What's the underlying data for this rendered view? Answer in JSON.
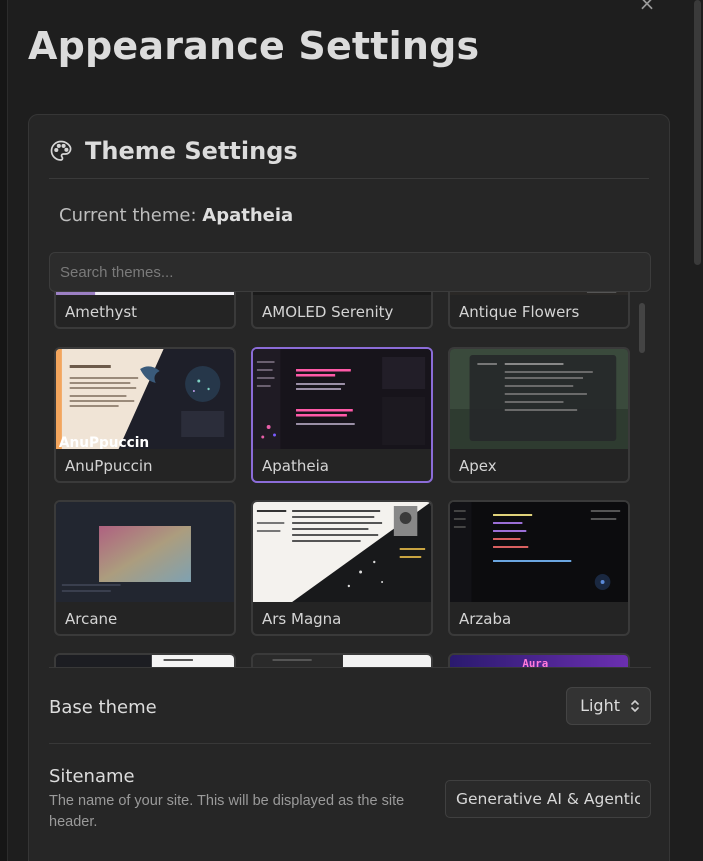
{
  "header": {
    "title": "Appearance Settings",
    "close_glyph": "×"
  },
  "theme_panel": {
    "title": "Theme Settings",
    "icon": "palette-icon",
    "current_label": "Current theme:",
    "current_value": "Apatheia",
    "search_placeholder": "Search themes...",
    "selected_theme": "Apatheia",
    "themes": [
      {
        "name": "Amethyst"
      },
      {
        "name": "AMOLED Serenity"
      },
      {
        "name": "Antique Flowers"
      },
      {
        "name": "AnuPpuccin",
        "thumb_text": "AnuPpuccin"
      },
      {
        "name": "Apatheia"
      },
      {
        "name": "Apex"
      },
      {
        "name": "Arcane"
      },
      {
        "name": "Ars Magna"
      },
      {
        "name": "Arzaba"
      },
      {
        "name": ""
      },
      {
        "name": ""
      },
      {
        "name": "",
        "thumb_text": "Aura"
      }
    ]
  },
  "settings": {
    "base_theme": {
      "label": "Base theme",
      "value": "Light"
    },
    "sitename": {
      "label": "Sitename",
      "description": "The name of your site. This will be displayed as the site header.",
      "value": "Generative AI & Agentic AI"
    }
  },
  "colors": {
    "background": "#1e1e1e",
    "panel": "#262626",
    "accent_selected": "#8b6cd8"
  }
}
